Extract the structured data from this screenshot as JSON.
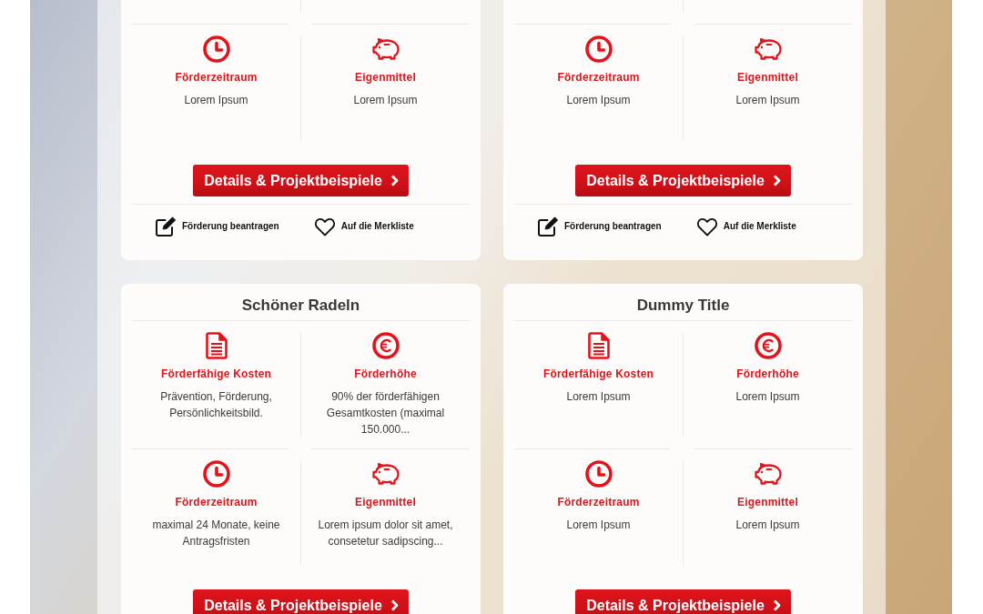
{
  "cards": [
    {
      "features": [
        {
          "kind": "period",
          "title": "Förderzeitraum",
          "text": "Lorem Ipsum"
        },
        {
          "kind": "own_funds",
          "title": "Eigenmittel",
          "text": "Lorem Ipsum"
        }
      ],
      "button": "Details & Projektbeispiele",
      "actions": [
        {
          "kind": "apply",
          "label": "Förderung beantragen"
        },
        {
          "kind": "bookmark",
          "label": "Auf die Merkliste"
        }
      ]
    },
    {
      "features": [
        {
          "kind": "period",
          "title": "Förderzeitraum",
          "text": "Lorem Ipsum"
        },
        {
          "kind": "own_funds",
          "title": "Eigenmittel",
          "text": "Lorem Ipsum"
        }
      ],
      "button": "Details & Projektbeispiele",
      "actions": [
        {
          "kind": "apply",
          "label": "Förderung beantragen"
        },
        {
          "kind": "bookmark",
          "label": "Auf die Merkliste"
        }
      ]
    },
    {
      "title": "Schöner Radeln",
      "features": [
        {
          "kind": "costs",
          "title": "Förderfähige Kosten",
          "text": "Prävention, Förderung, Persönlichkeitsbild."
        },
        {
          "kind": "amount",
          "title": "Förderhöhe",
          "text": "90% der förderfähigen Gesamtkosten (maximal 150.000..."
        },
        {
          "kind": "period",
          "title": "Förderzeitraum",
          "text": "maximal 24 Monate, keine Antragsfristen"
        },
        {
          "kind": "own_funds",
          "title": "Eigenmittel",
          "text": "Lorem ipsum dolor sit amet, consetetur sadipscing..."
        }
      ],
      "button": "Details & Projektbeispiele"
    },
    {
      "title": "Dummy Title",
      "features": [
        {
          "kind": "costs",
          "title": "Förderfähige Kosten",
          "text": "Lorem Ipsum"
        },
        {
          "kind": "amount",
          "title": "Förderhöhe",
          "text": "Lorem Ipsum"
        },
        {
          "kind": "period",
          "title": "Förderzeitraum",
          "text": "Lorem Ipsum"
        },
        {
          "kind": "own_funds",
          "title": "Eigenmittel",
          "text": "Lorem Ipsum"
        }
      ],
      "button": "Details & Projektbeispiele"
    }
  ]
}
